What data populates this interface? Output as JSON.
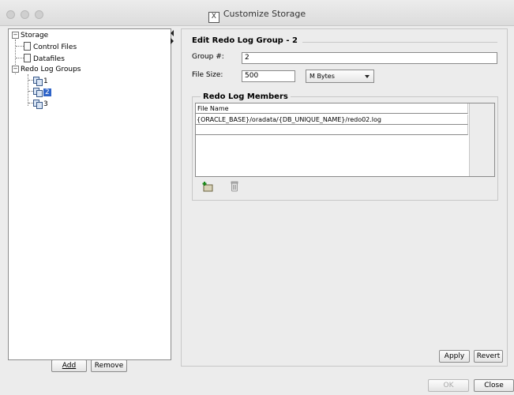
{
  "window": {
    "title": "Customize Storage"
  },
  "tree": {
    "root": "Storage",
    "items": [
      "Control Files",
      "Datafiles",
      "Redo Log Groups"
    ],
    "groups": [
      "1",
      "2",
      "3"
    ],
    "selected_group": "2"
  },
  "left_buttons": {
    "add": "Add",
    "remove": "Remove"
  },
  "edit": {
    "title": "Edit Redo Log Group - 2",
    "group_label": "Group #:",
    "group_value": "2",
    "size_label": "File Size:",
    "size_value": "500",
    "unit": "M Bytes"
  },
  "members": {
    "title": "Redo Log Members",
    "column": "File Name",
    "rows": [
      "{ORACLE_BASE}/oradata/{DB_UNIQUE_NAME}/redo02.log",
      ""
    ]
  },
  "panel_buttons": {
    "apply": "Apply",
    "revert": "Revert"
  },
  "dialog_buttons": {
    "ok": "OK",
    "close": "Close"
  },
  "icons": {
    "add_member": "add-member-icon",
    "delete_member": "trash-icon"
  }
}
